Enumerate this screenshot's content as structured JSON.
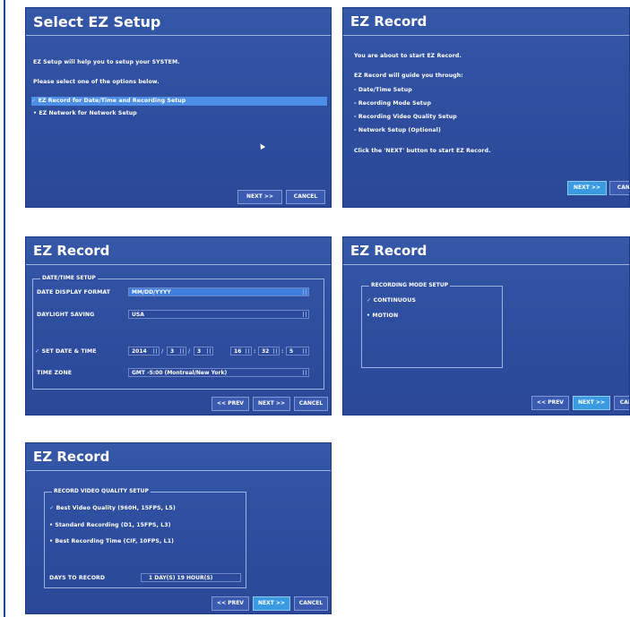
{
  "panel1": {
    "title": "Select EZ Setup",
    "intro1": "EZ Setup will help you to setup your SYSTEM.",
    "intro2": "Please select one of the options below.",
    "option1": "EZ Record for Date/Time and Recording Setup",
    "option2": "EZ Network for Network Setup",
    "next": "NEXT >>",
    "cancel": "CANCEL"
  },
  "panel2": {
    "title": "EZ Record",
    "line1": "You are about to start EZ Record.",
    "line2": "EZ Record will guide you through:",
    "steps": [
      "- Date/Time Setup",
      "- Recording Mode Setup",
      "- Recording Video Quality Setup",
      "- Network Setup (Optional)"
    ],
    "line3": "Click the 'NEXT' button to start EZ Record.",
    "next": "NEXT >>",
    "cancel": "CANCEL"
  },
  "panel3": {
    "title": "EZ Record",
    "section": "DATE/TIME SETUP",
    "date_format_label": "DATE DISPLAY FORMAT",
    "date_format_value": "MM/DD/YYYY",
    "dst_label": "DAYLIGHT SAVING",
    "dst_value": "USA",
    "set_date_label": "SET DATE & TIME",
    "year": "2014",
    "month": "3",
    "day": "3",
    "hour": "16",
    "minute": "32",
    "second": "5",
    "sep_slash": "/",
    "sep_colon": ":",
    "tz_label": "TIME ZONE",
    "tz_value": "GMT -5:00 (Montreal/New York)",
    "prev": "<< PREV",
    "next": "NEXT >>",
    "cancel": "CANCEL"
  },
  "panel4": {
    "title": "EZ Record",
    "section": "RECORDING MODE SETUP",
    "opt1": "CONTINUOUS",
    "opt2": "MOTION",
    "prev": "<< PREV",
    "next": "NEXT >>",
    "cancel": "CANCEL"
  },
  "panel5": {
    "title": "EZ Record",
    "section": "RECORD VIDEO QUALITY SETUP",
    "opt1": "Best Video Quality (960H, 15FPS, L5)",
    "opt2": "Standard Recording (D1, 15FPS, L3)",
    "opt3": "Best Recording Time (CIF, 10FPS, L1)",
    "days_label": "DAYS TO RECORD",
    "days_value": "1 DAY(S) 19 HOUR(S)",
    "prev": "<< PREV",
    "next": "NEXT >>",
    "cancel": "CANCEL"
  },
  "colors": {
    "panel_bg": "#2f4fa0",
    "highlight": "#4d8fe6",
    "active_button": "#3a9be0"
  }
}
